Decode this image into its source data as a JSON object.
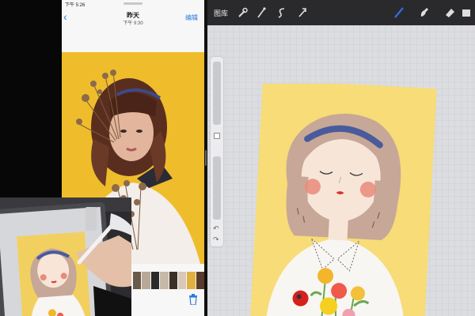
{
  "photos": {
    "status_time": "下午 5:26",
    "title": "昨天",
    "subtitle": "下午 9:30",
    "edit_label": "编辑",
    "thumbnail_colors": [
      "#6a5a4a",
      "#b8a898",
      "#2a2a2a",
      "#c8b8a8",
      "#3a3028",
      "#d8c8b8",
      "#e0b040",
      "#5a3a2a"
    ]
  },
  "procreate": {
    "gallery_label": "图库",
    "toolbar_icons": [
      "wrench-icon",
      "adjustments-icon",
      "selection-icon",
      "transform-icon",
      "brush-icon",
      "smudge-icon",
      "eraser-icon"
    ],
    "accent": "#2f6fe0"
  },
  "colors": {
    "background_yellow": "#f2c230",
    "canvas_yellow": "#f4d463",
    "hair": "#c7a797",
    "headband": "#4a5b9c"
  }
}
